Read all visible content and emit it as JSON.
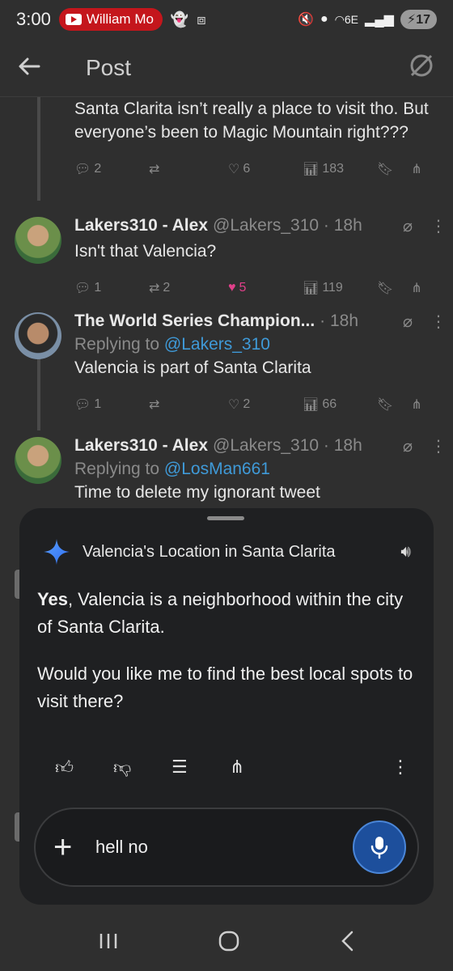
{
  "status_bar": {
    "time": "3:00",
    "youtube_label": "William Mo",
    "battery": "17",
    "network": "6E"
  },
  "header": {
    "title": "Post"
  },
  "tweets": [
    {
      "name": "",
      "handle": "",
      "text": "Santa Clarita isn’t really a place to visit tho. But everyone’s been to Magic Mountain right???",
      "replies": "2",
      "reposts": "",
      "likes": "6",
      "views": "183"
    },
    {
      "name": "Lakers310 - Alex",
      "handle": "@Lakers_310 · 18h",
      "text": "Isn't that Valencia?",
      "replies": "1",
      "reposts": "2",
      "likes": "5",
      "views": "119"
    },
    {
      "name": "The World Series Champion...",
      "handle": "· 18h",
      "replying_prefix": "Replying to ",
      "replying_to": "@Lakers_310",
      "text": "Valencia is part of Santa Clarita",
      "replies": "1",
      "reposts": "",
      "likes": "2",
      "views": "66"
    },
    {
      "name": "Lakers310 - Alex",
      "handle": "@Lakers_310 · 18h",
      "replying_prefix": "Replying to ",
      "replying_to": "@LosMan661",
      "text": "Time to delete my ignorant tweet"
    }
  ],
  "assistant": {
    "title": "Valencia's Location in Santa Clarita",
    "answer_bold": "Yes",
    "answer_rest": ", Valencia is a neighborhood within the city of Santa Clarita.",
    "followup": "Would you like me to find the best local spots to visit there?",
    "input_value": "hell no"
  },
  "colors": {
    "background": "#2f2f2f",
    "card": "#1f2022",
    "mention": "#3f9ad8",
    "like": "#e0408a",
    "mic": "#1d4f9c",
    "youtube": "#c4161c"
  }
}
